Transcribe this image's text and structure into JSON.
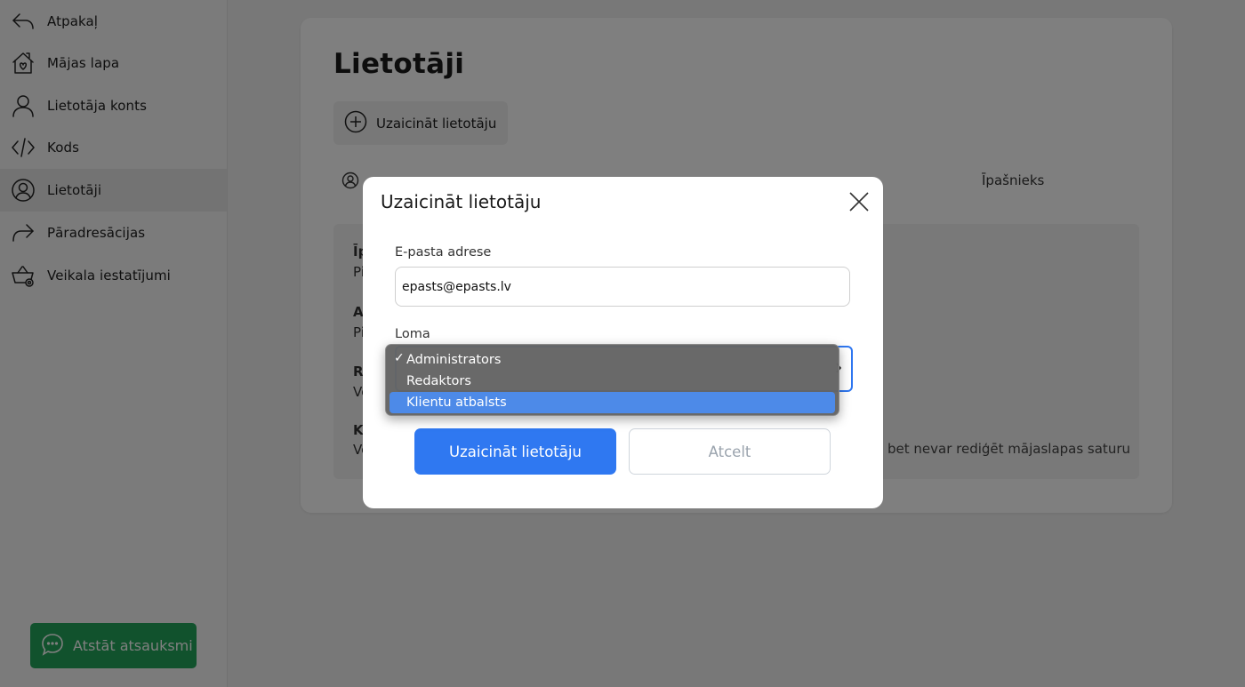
{
  "sidebar": {
    "items": [
      {
        "label": "Atpakaļ",
        "icon": "back-arrow-icon"
      },
      {
        "label": "Mājas lapa",
        "icon": "home-icon"
      },
      {
        "label": "Lietotāja konts",
        "icon": "user-icon"
      },
      {
        "label": "Kods",
        "icon": "code-icon"
      },
      {
        "label": "Lietotāji",
        "icon": "users-icon",
        "active": true
      },
      {
        "label": "Pāradresācijas",
        "icon": "redirect-arrow-icon"
      },
      {
        "label": "Veikala iestatījumi",
        "icon": "cart-settings-icon"
      }
    ],
    "feedback_label": "Atstāt atsauksmi"
  },
  "main": {
    "title": "Lietotāji",
    "invite_button_label": "Uzaicināt lietotāju",
    "owner_label": "Īpašnieks",
    "roles_partial": [
      "Īp",
      "Pi",
      "Ad",
      "Pi",
      "Re",
      "Ve",
      "Kl",
      "Ve"
    ],
    "role_desc_fragment": "bet nevar rediģēt mājaslapas saturu"
  },
  "modal": {
    "title": "Uzaicināt lietotāju",
    "email_label": "E-pasta adrese",
    "email_value": "epasts@epasts.lv",
    "role_label": "Loma",
    "submit_label": "Uzaicināt lietotāju",
    "cancel_label": "Atcelt"
  },
  "dropdown": {
    "check": "✓",
    "options": [
      "Administrators",
      "Redaktors",
      "Klientu atbalsts"
    ],
    "selected_index": 0,
    "highlighted_index": 2
  },
  "colors": {
    "primary": "#2f78f1",
    "feedback": "#23a55a",
    "highlight": "#4d8ae8"
  }
}
